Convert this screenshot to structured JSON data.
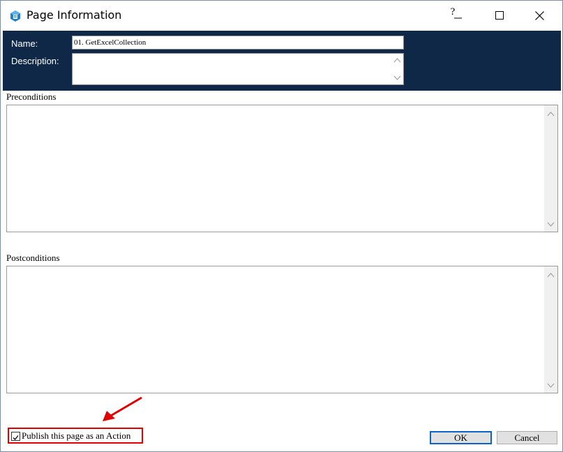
{
  "window": {
    "title": "Page Information",
    "help_label": "?"
  },
  "form": {
    "name_label": "Name:",
    "name_value": "01. GetExcelCollection",
    "description_label": "Description:",
    "description_value": "",
    "preconditions_label": "Preconditions",
    "postconditions_label": "Postconditions"
  },
  "footer": {
    "publish_label": "Publish this page as an Action",
    "publish_checked": true,
    "ok_label": "OK",
    "cancel_label": "Cancel"
  },
  "colors": {
    "header_bg": "#0f2848",
    "highlight": "#e00000",
    "ok_border": "#0a64c8"
  }
}
